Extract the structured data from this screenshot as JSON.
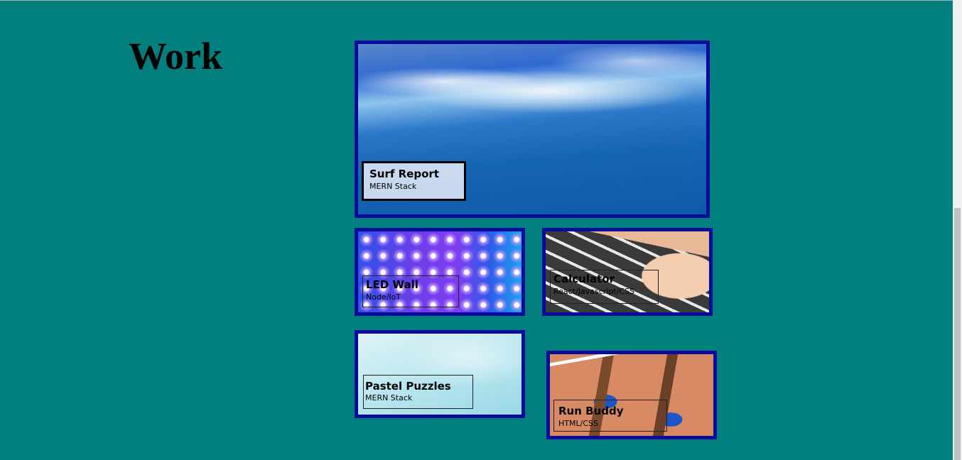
{
  "page": {
    "heading": "Work",
    "background_color": "#017f7f",
    "card_border_color": "#0b0b9b"
  },
  "projects": [
    {
      "title": "Surf Report",
      "subtitle": "MERN Stack",
      "image": "ocean-wave-image"
    },
    {
      "title": "LED Wall",
      "subtitle": "Node/IoT",
      "image": "led-matrix-image"
    },
    {
      "title": "Calculator",
      "subtitle": "React/Javascript/CSS",
      "image": "calculator-keypad-image"
    },
    {
      "title": "Pastel Puzzles",
      "subtitle": "MERN Stack",
      "image": "pastel-texture-image"
    },
    {
      "title": "Run Buddy",
      "subtitle": "HTML/CSS",
      "image": "runner-track-image"
    }
  ]
}
